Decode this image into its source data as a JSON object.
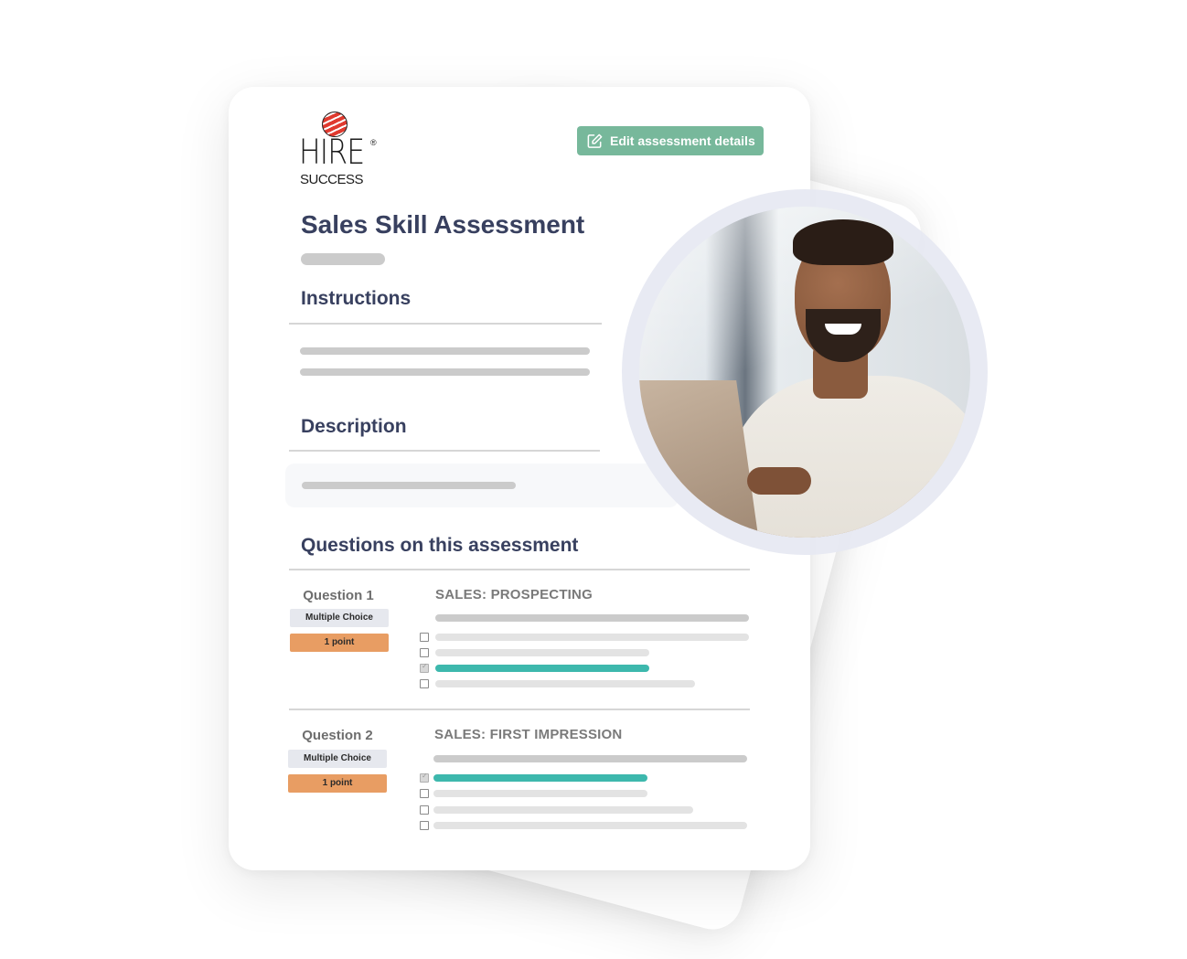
{
  "brand": {
    "logo_main": "HIRE",
    "logo_registered": "®",
    "logo_sub": "SUCCESS"
  },
  "toolbar": {
    "edit_label": "Edit assessment details",
    "edit_icon": "edit-icon",
    "accent_color": "#77b89b"
  },
  "assessment": {
    "title": "Sales Skill Assessment",
    "sections": {
      "instructions": "Instructions",
      "description": "Description",
      "questions": "Questions on this assessment"
    }
  },
  "questions": [
    {
      "label": "Question 1",
      "type": "Multiple Choice",
      "points": "1 point",
      "category": "SALES: PROSPECTING",
      "options": [
        {
          "checked": false,
          "correct": false
        },
        {
          "checked": false,
          "correct": false
        },
        {
          "checked": true,
          "correct": true
        },
        {
          "checked": false,
          "correct": false
        }
      ]
    },
    {
      "label": "Question 2",
      "type": "Multiple Choice",
      "points": "1 point",
      "category": "SALES: FIRST IMPRESSION",
      "options": [
        {
          "checked": true,
          "correct": true
        },
        {
          "checked": false,
          "correct": false
        },
        {
          "checked": false,
          "correct": false
        },
        {
          "checked": false,
          "correct": false
        }
      ]
    }
  ],
  "colors": {
    "heading": "#38405f",
    "correct_answer": "#3db8ad",
    "points_badge": "#e89d63",
    "type_badge": "#e6e8ee"
  },
  "photo": {
    "alt": "Smiling man in white shirt working on a laptop"
  }
}
